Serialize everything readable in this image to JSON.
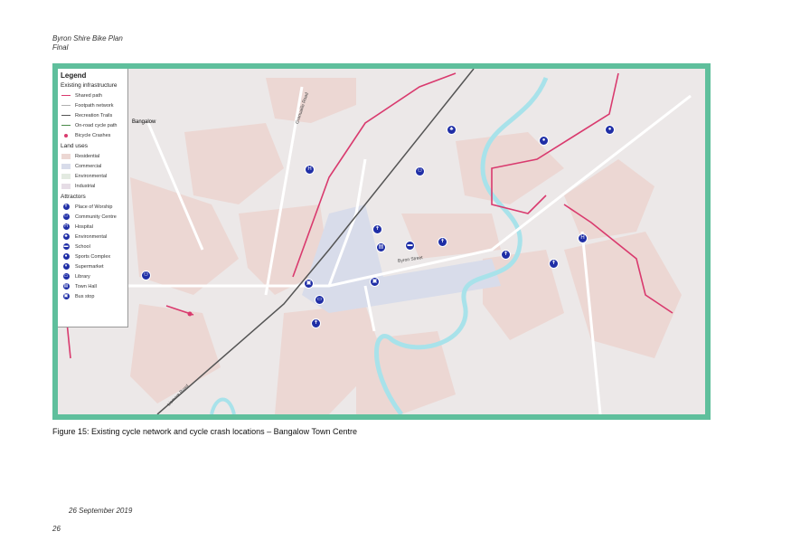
{
  "header": {
    "line1": "Byron Shire Bike Plan",
    "line2": "Final"
  },
  "colors": {
    "frame": "#5fbf9c",
    "shared_path": "#d93a6e",
    "footpath": "#b0b0b0",
    "recreation_trail": "#555555",
    "on_road": "#4a8a4a",
    "crash": "#d93a6e",
    "residential": "#ecd7d3",
    "commercial": "#d8dcea",
    "environmental": "#e3eae1",
    "industrial": "#e6dde6",
    "attractor": "#1f2ea6",
    "water": "#a8e2ea"
  },
  "legend": {
    "title": "Legend",
    "sections": [
      {
        "heading": "Existing infrastructure",
        "items": [
          {
            "label": "Shared path",
            "kind": "line",
            "color": "#d93a6e"
          },
          {
            "label": "Footpath network",
            "kind": "line",
            "color": "#b0b0b0"
          },
          {
            "label": "Recreation Trails",
            "kind": "line",
            "color": "#555555"
          },
          {
            "label": "On-road cycle path",
            "kind": "line",
            "color": "#4a8a4a"
          },
          {
            "label": "Bicycle Crashes",
            "kind": "dot",
            "color": "#d93a6e"
          }
        ]
      },
      {
        "heading": "Land uses",
        "items": [
          {
            "label": "Residential",
            "kind": "fill",
            "color": "#ecd7d3"
          },
          {
            "label": "Commercial",
            "kind": "fill",
            "color": "#d8dcea"
          },
          {
            "label": "Environmental",
            "kind": "fill",
            "color": "#e3eae1"
          },
          {
            "label": "Industrial",
            "kind": "fill",
            "color": "#e6dde6"
          }
        ]
      },
      {
        "heading": "Attractors",
        "items": [
          {
            "label": "Place of Worship",
            "kind": "icon",
            "glyph": "✝",
            "icon": "worship-icon"
          },
          {
            "label": "Community Centre",
            "kind": "icon",
            "glyph": "⚇",
            "icon": "community-icon"
          },
          {
            "label": "Hospital",
            "kind": "icon",
            "glyph": "H",
            "icon": "hospital-icon"
          },
          {
            "label": "Environmental",
            "kind": "icon",
            "glyph": "♣",
            "icon": "environment-icon"
          },
          {
            "label": "School",
            "kind": "icon",
            "glyph": "▬",
            "icon": "school-icon"
          },
          {
            "label": "Sports Complex",
            "kind": "icon",
            "glyph": "●",
            "icon": "sports-icon"
          },
          {
            "label": "Supermarket",
            "kind": "icon",
            "glyph": "▾",
            "icon": "supermarket-icon"
          },
          {
            "label": "Library",
            "kind": "icon",
            "glyph": "▭",
            "icon": "library-icon"
          },
          {
            "label": "Town Hall",
            "kind": "icon",
            "glyph": "▤",
            "icon": "townhall-icon"
          },
          {
            "label": "Bus stop",
            "kind": "icon",
            "glyph": "▣",
            "icon": "bus-icon"
          }
        ]
      }
    ]
  },
  "map_labels": {
    "town": "Bangalow",
    "byron_street": "Byron Street",
    "granuaille_road": "Granuaille Road",
    "lismore_road": "Lismore Road"
  },
  "caption": "Figure 15: Existing cycle network and cycle crash locations – Bangalow Town Centre",
  "footer": {
    "date": "26 September 2019",
    "page": "26"
  }
}
